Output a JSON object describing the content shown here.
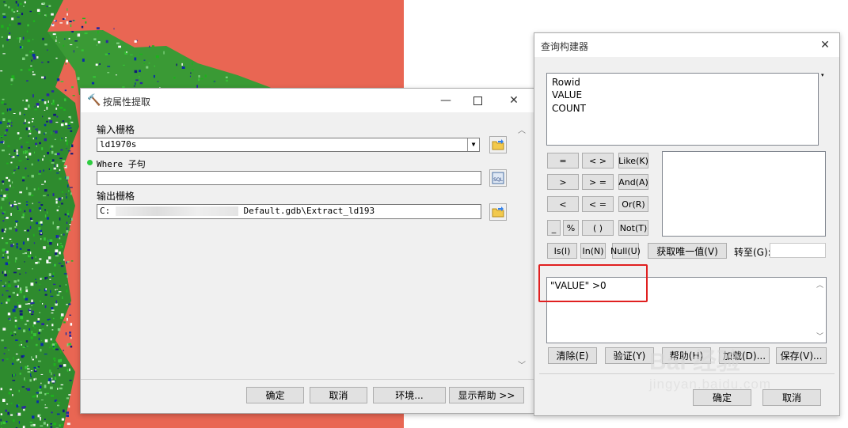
{
  "dialog1": {
    "title": "按属性提取",
    "input_label": "输入栅格",
    "input_value": "ld1970s",
    "where_label": "Where 子句",
    "where_value": "",
    "sql_label": "SQL",
    "output_label": "输出栅格",
    "output_prefix": "C:",
    "output_suffix": "Default.gdb\\Extract_ld193",
    "buttons": {
      "ok": "确定",
      "cancel": "取消",
      "env": "环境...",
      "help": "显示帮助 >>"
    }
  },
  "dialog2": {
    "title": "查询构建器",
    "fields": [
      "Rowid",
      "VALUE",
      "COUNT"
    ],
    "ops": {
      "eq": "=",
      "ne": "< >",
      "like": "Like(K)",
      "gt": ">",
      "ge": "> =",
      "and": "And(A)",
      "lt": "<",
      "le": "< =",
      "or": "Or(R)",
      "us": "_",
      "pct": "%",
      "paren": "( )",
      "not": "Not(T)",
      "is": "Is(I)",
      "in": "In(N)",
      "null": "Null(U)"
    },
    "unique_label": "获取唯一值(V)",
    "goto_label": "转至(G):",
    "expression": "\"VALUE\" >0",
    "bottom": {
      "clear": "清除(E)",
      "verify": "验证(Y)",
      "help": "帮助(H)",
      "load": "加载(D)...",
      "save": "保存(V)..."
    },
    "footer": {
      "ok": "确定",
      "cancel": "取消"
    }
  },
  "watermark": {
    "text": "Bai 经验",
    "url": "jingyan.baidu.com"
  },
  "colors": {
    "map_bg": "#e96653",
    "highlight": "#e02020"
  }
}
